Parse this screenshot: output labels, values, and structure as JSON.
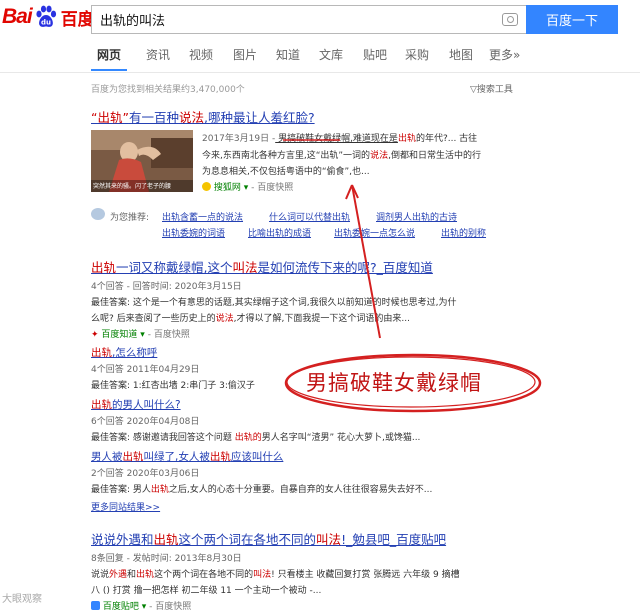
{
  "header": {
    "logo_left": "Bai",
    "logo_right": "百度",
    "search_value": "出轨的叫法",
    "search_button": "百度一下"
  },
  "tabs": [
    "网页",
    "资讯",
    "视频",
    "图片",
    "知道",
    "文库",
    "贴吧",
    "采购",
    "地图",
    "更多»"
  ],
  "result_count": "百度为您找到相关结果约3,470,000个",
  "search_tools": "搜索工具",
  "result1": {
    "title_a": "“出轨”",
    "title_b": "有一百种",
    "title_c": "说法",
    "title_d": ",哪种最让人羞红脸?",
    "line1_date": "2017年3月19日 -",
    "line1_text": " 男搞破鞋女戴绿帽,难道现在是",
    "line1_red": "出轨",
    "line1_tail": "的年代?... 古往",
    "line2_a": "今来,东西南北各种方言里,这“出轨”一词的",
    "line2_red": "说法",
    "line2_b": ",倒都和日常生活中的行",
    "line3": "为息息相关,不仅包括粤语中的“偷食”,也...",
    "source": "搜狐网",
    "snapshot": "百度快照",
    "thumb_caption": "突然其来的骚。闪了老子的腰"
  },
  "recommend": {
    "label": "为您推荐:",
    "links": [
      "出轨含蓄一点的说法",
      "什么词可以代替出轨",
      "调剂男人出轨的古诗",
      "出轨委婉的词语",
      "比喻出轨的成语",
      "出轨委婉一点怎么说",
      "出轨的别称"
    ]
  },
  "result2": {
    "title_a": "出轨",
    "title_b": "一词又称戴绿帽,这个",
    "title_c": "叫法",
    "title_d": "是如何流传下来的呢?_百度知道",
    "meta": "4个回答 - 回答时间: 2020年3月15日",
    "best_a": "最佳答案: 这个是一个有意思的话题,其实绿帽子这个词,我很久以前知道的时候也思考过,为什",
    "best_b_a": "么呢? 后来查阅了一些历史上的",
    "best_b_red": "说法",
    "best_b_b": ",才得以了解,下面我提一下这个词语的由来...",
    "source": "百度知道",
    "snapshot": "百度快照"
  },
  "sub_answers": [
    {
      "title_a": "出轨",
      "title_b": ",怎么称呼",
      "meta": "4个回答    2011年04月29日",
      "best": "最佳答案: 1:红杏出墙 2:串门子 3:偷汉子"
    },
    {
      "title_a": "出轨",
      "title_b": "的男人叫什么?",
      "meta": "6个回答    2020年04月08日",
      "best_a": "最佳答案: 感谢邀请我回答这个问题 ",
      "best_red": "出轨的",
      "best_b": "男人名字叫“渣男” 花心大萝卜,或馋猫..."
    },
    {
      "title_a": "男人被",
      "title_red": "出轨",
      "title_b": "叫绿了,女人被",
      "title_red2": "出轨",
      "title_c": "应该叫什么",
      "meta": "2个回答    2020年03月06日",
      "best_a": "最佳答案: 男人",
      "best_red": "出轨",
      "best_b": "之后,女人的心态十分重要。自暴自弃的女人往往很容易失去好不..."
    }
  ],
  "more_related": "更多同站结果>>",
  "result3": {
    "title_a": "说说外遇和",
    "title_red1": "出轨",
    "title_b": "这个两个词在各地不同的",
    "title_red2": "叫法",
    "title_c": "!_勉县吧_百度贴吧",
    "meta": "8条回复 - 发帖时间: 2013年8月30日",
    "line_a": "说说",
    "line_red1": "外遇",
    "line_b": "和",
    "line_red2": "出轨",
    "line_c": "这个两个词在各地不同的",
    "line_red3": "叫法",
    "line_d": "! 只看楼主 收藏回复打赏 张腾远 六年级 9 摘槽",
    "line2": "八 () 打赏 撸一把怎样 初二年级 11 一个主动一个被动 -...",
    "source": "百度贴吧",
    "snapshot": "百度快照"
  },
  "annotation": "男搞破鞋女戴绿帽",
  "watermark": "大眼观察"
}
